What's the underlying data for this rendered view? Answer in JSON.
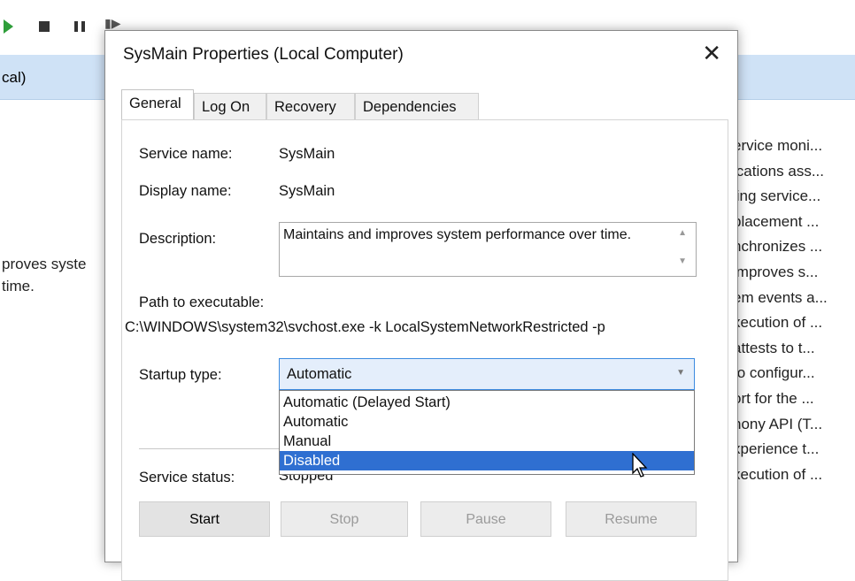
{
  "background": {
    "header_text": "cal)",
    "left_text": [
      "proves syste",
      " time."
    ],
    "right_column": [
      "ervice moni...",
      "ications ass...",
      "ling service...",
      "placement ...",
      "nchronizes ...",
      "improves s...",
      "em events a...",
      "xecution of ...",
      "attests to t...",
      "to configur...",
      "ort for the ...",
      "hony API (T...",
      "xperience t...",
      "xecution of ..."
    ]
  },
  "dialog": {
    "title": "SysMain Properties (Local Computer)",
    "close_glyph": "✕",
    "tabs": [
      "General",
      "Log On",
      "Recovery",
      "Dependencies"
    ],
    "active_tab": "General",
    "service_name_label": "Service name:",
    "service_name_value": "SysMain",
    "display_name_label": "Display name:",
    "display_name_value": "SysMain",
    "description_label": "Description:",
    "description_value": "Maintains and improves system performance over time.",
    "path_label": "Path to executable:",
    "path_value": "C:\\WINDOWS\\system32\\svchost.exe -k LocalSystemNetworkRestricted -p",
    "startup_label": "Startup type:",
    "startup_value": "Automatic",
    "startup_options": [
      "Automatic (Delayed Start)",
      "Automatic",
      "Manual",
      "Disabled"
    ],
    "highlighted_option": "Disabled",
    "status_label": "Service status:",
    "status_value": "Stopped",
    "buttons": {
      "start": "Start",
      "stop": "Stop",
      "pause": "Pause",
      "resume": "Resume"
    }
  },
  "colors": {
    "selection": "#2f6fd1",
    "header_bg": "#cfe2f6",
    "select_border": "#3c8be0"
  },
  "icons": [
    "play-icon",
    "stop-icon",
    "pause-icon",
    "restart-icon",
    "close-icon",
    "chevron-down-icon",
    "mouse-cursor-icon"
  ]
}
